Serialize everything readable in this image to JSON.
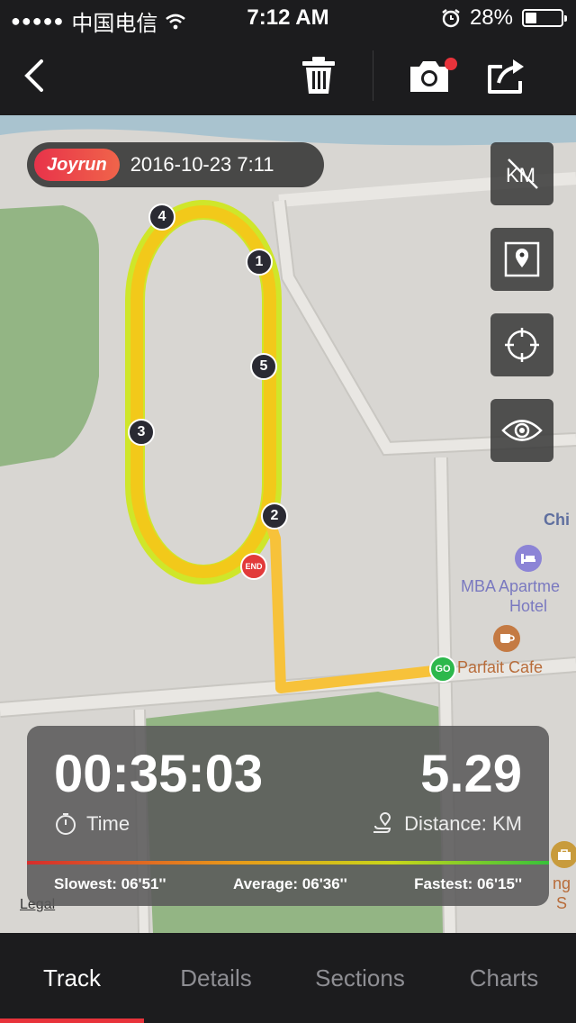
{
  "status_bar": {
    "signal_dots": "●●●●●",
    "carrier": "中国电信",
    "time": "7:12 AM",
    "battery_percent": "28%",
    "battery_level": 0.28
  },
  "nav": {
    "back_icon": "chevron-left-icon",
    "trash_icon": "trash-icon",
    "camera_icon": "camera-icon",
    "share_icon": "share-icon",
    "camera_badge_color": "#e8333b"
  },
  "map": {
    "brand": "Joyrun",
    "datetime": "2016-10-23 7:11",
    "buttons": [
      {
        "name": "km-toggle",
        "icon": "km-off-icon",
        "label": "KM"
      },
      {
        "name": "map-style",
        "icon": "map-pin-icon"
      },
      {
        "name": "locate",
        "icon": "crosshair-icon"
      },
      {
        "name": "visibility",
        "icon": "eye-icon"
      }
    ],
    "markers": {
      "k1": "1",
      "k2": "2",
      "k3": "3",
      "k4": "4",
      "k5": "5",
      "end": "END",
      "go": "GO"
    },
    "poi": {
      "chi": "Chi",
      "hotel_line1": "MBA Apartme",
      "hotel_line2": "Hotel",
      "cafe": "Parfait Cafe",
      "partial": "ng S"
    },
    "legal": "Legal",
    "route_color": "#f5c518",
    "route_secondary_color": "#cfe62a"
  },
  "stats": {
    "time_value": "00:35:03",
    "time_label": "Time",
    "distance_value": "5.29",
    "distance_label": "Distance: KM",
    "slowest": "Slowest: 06'51''",
    "average": "Average: 06'36''",
    "fastest": "Fastest: 06'15''"
  },
  "tabs": [
    {
      "label": "Track",
      "active": true
    },
    {
      "label": "Details",
      "active": false
    },
    {
      "label": "Sections",
      "active": false
    },
    {
      "label": "Charts",
      "active": false
    }
  ],
  "accent_color": "#e8333b"
}
